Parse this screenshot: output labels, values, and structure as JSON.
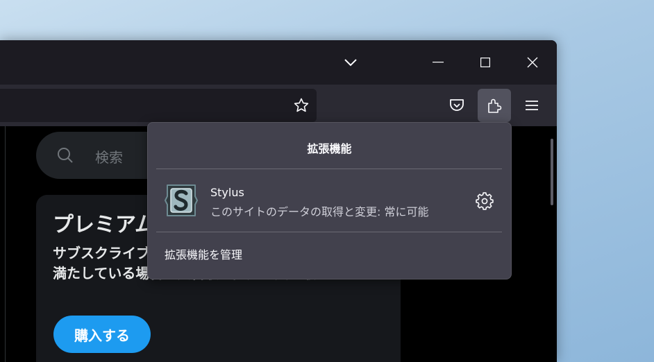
{
  "toolbar": {
    "extensions_button": "extensions-icon"
  },
  "content": {
    "search_placeholder": "検索",
    "premium_card": {
      "title": "プレミアム",
      "body": "サブスクライブして新機能を利用しましょう。資格を満たしている場合、広告収益配分を受け取れます。",
      "button": "購入する"
    }
  },
  "extensions_panel": {
    "title": "拡張機能",
    "extension": {
      "name": "Stylus",
      "permission": "このサイトのデータの取得と変更: 常に可能"
    },
    "manage_label": "拡張機能を管理"
  },
  "colors": {
    "accent": "#1d9bf0",
    "panel_bg": "#42414d",
    "toolbar_bg": "#2b2a33",
    "titlebar_bg": "#1c1b22"
  }
}
